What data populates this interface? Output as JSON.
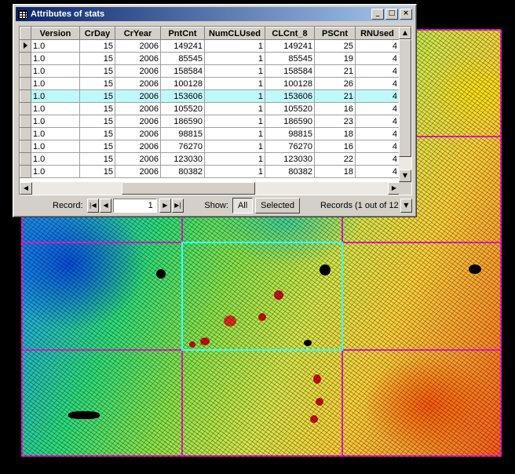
{
  "window": {
    "title": "Attributes of stats",
    "minimize_glyph": "_",
    "maximize_glyph": "□",
    "close_glyph": "×"
  },
  "table": {
    "columns": [
      "Version",
      "CrDay",
      "CrYear",
      "PntCnt",
      "NumCLUsed",
      "CLCnt_8",
      "PSCnt",
      "RNUsed"
    ],
    "rows": [
      [
        "1.0",
        "15",
        "2006",
        "149241",
        "1",
        "149241",
        "25",
        "4"
      ],
      [
        "1.0",
        "15",
        "2006",
        "85545",
        "1",
        "85545",
        "19",
        "4"
      ],
      [
        "1.0",
        "15",
        "2006",
        "158584",
        "1",
        "158584",
        "21",
        "4"
      ],
      [
        "1.0",
        "15",
        "2006",
        "100128",
        "1",
        "100128",
        "26",
        "4"
      ],
      [
        "1.0",
        "15",
        "2006",
        "153606",
        "1",
        "153606",
        "21",
        "4"
      ],
      [
        "1.0",
        "15",
        "2006",
        "105520",
        "1",
        "105520",
        "16",
        "4"
      ],
      [
        "1.0",
        "15",
        "2006",
        "186590",
        "1",
        "186590",
        "23",
        "4"
      ],
      [
        "1.0",
        "15",
        "2006",
        "98815",
        "1",
        "98815",
        "18",
        "4"
      ],
      [
        "1.0",
        "15",
        "2006",
        "76270",
        "1",
        "76270",
        "16",
        "4"
      ],
      [
        "1.0",
        "15",
        "2006",
        "123030",
        "1",
        "123030",
        "22",
        "4"
      ],
      [
        "1.0",
        "15",
        "2006",
        "80382",
        "1",
        "80382",
        "18",
        "4"
      ]
    ],
    "current_row": 0,
    "highlighted_row": 4
  },
  "navigation": {
    "record_label": "Record:",
    "record_value": "1",
    "show_label": "Show:",
    "all_label": "All",
    "selected_label": "Selected",
    "records_status": "Records (1 out of 12"
  },
  "colors": {
    "tile_border": "#ff1ad9",
    "selected_tile_border": "#33ffff",
    "highlight_row": "#bff8fb",
    "title_bar": "#0a246a"
  }
}
